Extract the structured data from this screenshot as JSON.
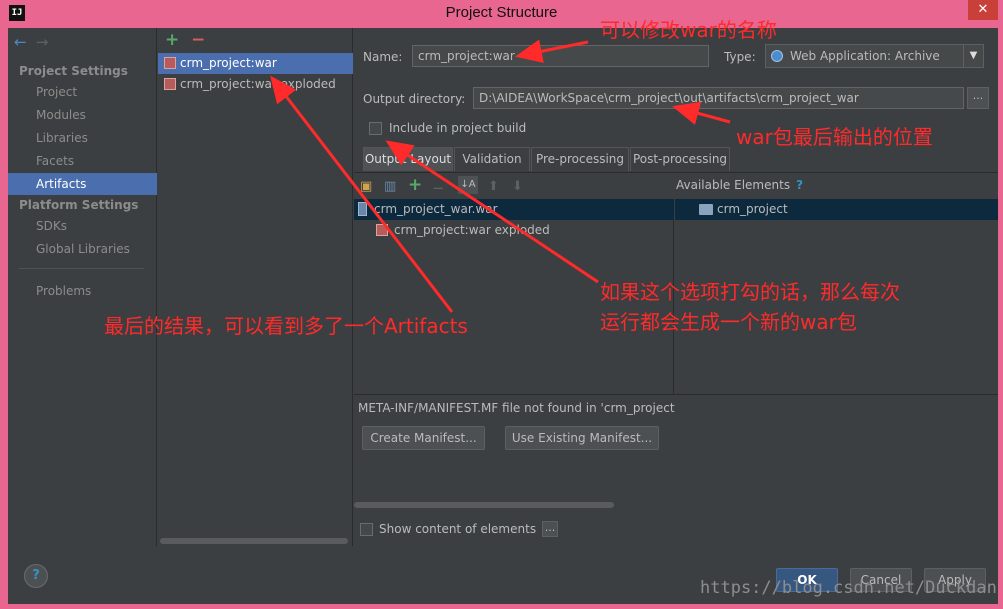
{
  "window": {
    "title": "Project Structure",
    "app_icon": "IJ",
    "close_label": "✕"
  },
  "nav": {
    "back_icon": "←",
    "forward_icon": "→",
    "group_project": "Project Settings",
    "group_platform": "Platform Settings",
    "items": [
      {
        "label": "Project"
      },
      {
        "label": "Modules"
      },
      {
        "label": "Libraries"
      },
      {
        "label": "Facets"
      },
      {
        "label": "Artifacts"
      },
      {
        "label": "SDKs"
      },
      {
        "label": "Global Libraries"
      },
      {
        "label": "Problems"
      }
    ],
    "selected": "Artifacts"
  },
  "artifacts": {
    "add_icon": "+",
    "remove_icon": "−",
    "items": [
      {
        "label": "crm_project:war"
      },
      {
        "label": "crm_project:war exploded"
      }
    ]
  },
  "detail": {
    "name_label": "Name:",
    "name_value": "crm_project:war",
    "type_label": "Type:",
    "type_value": "Web Application: Archive",
    "output_label": "Output directory:",
    "output_value": "D:\\AIDEA\\WorkSpace\\crm_project\\out\\artifacts\\crm_project_war",
    "browse_label": "...",
    "include_build_label": "Include in project build",
    "tabs": [
      {
        "label": "Output Layout"
      },
      {
        "label": "Validation"
      },
      {
        "label": "Pre-processing"
      },
      {
        "label": "Post-processing"
      }
    ],
    "available_label": "Available Elements",
    "help_q": "?",
    "layout_root": "crm_project_war.war",
    "layout_child": "crm_project:war exploded",
    "available_item": "crm_project",
    "manifest_msg": "META-INF/MANIFEST.MF file not found in 'crm_project",
    "create_manifest": "Create Manifest...",
    "use_existing_manifest": "Use Existing Manifest...",
    "show_content_label": "Show content of elements",
    "show_content_btn": "..."
  },
  "footer": {
    "help": "?",
    "ok": "OK",
    "cancel": "Cancel",
    "apply": "Apply"
  },
  "annotations": {
    "rename": "可以修改war的名称",
    "output_location": "war包最后输出的位置",
    "result": "最后的结果，可以看到多了一个Artifacts",
    "include_line1": "如果这个选项打勾的话，那么每次",
    "include_line2": "运行都会生成一个新的war包"
  },
  "watermark": "https://blog.csdn.net/Duckdan",
  "colors": {
    "frame": "#e8668f",
    "panel": "#3c3f41",
    "selection": "#4b6eaf",
    "annotation": "#ff2a2a"
  }
}
